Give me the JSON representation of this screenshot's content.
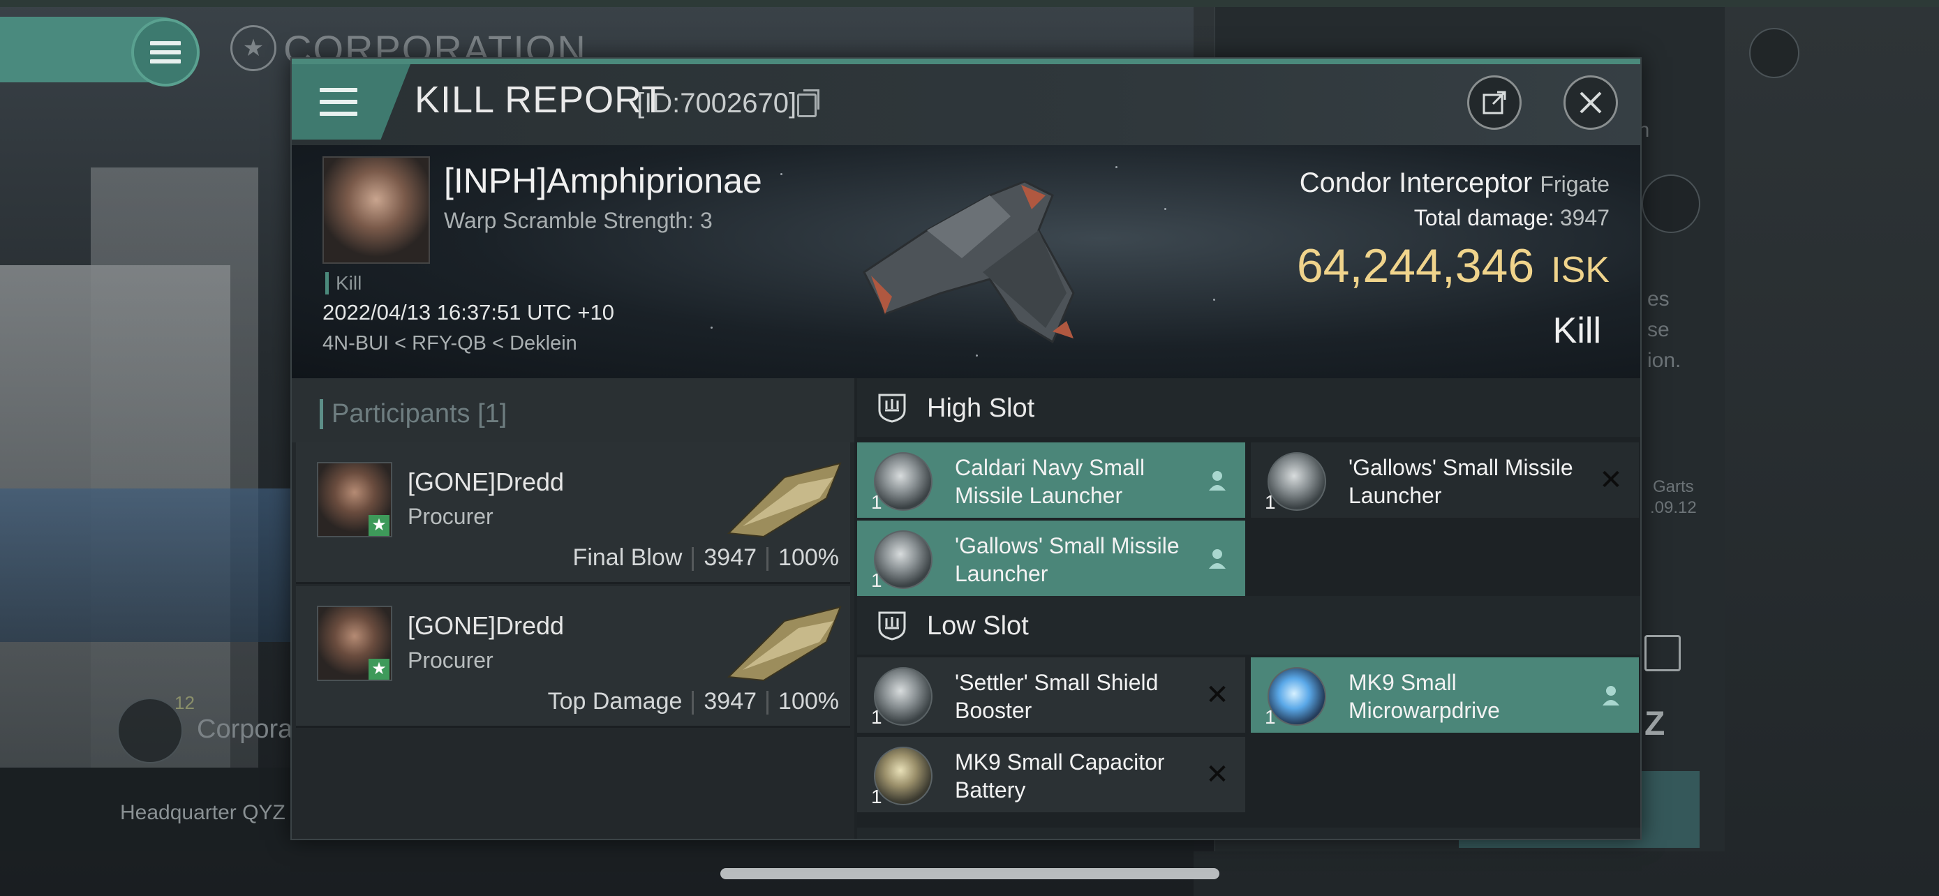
{
  "background": {
    "corp_title": "CORPORATION",
    "corp_sub": "Corpora",
    "corp_sub_badge": "12",
    "hq_label": "Headquarter QYZ",
    "right_fragments": [
      "en",
      "es",
      "se",
      "ion.",
      "Garts",
      ".09.12"
    ]
  },
  "window": {
    "title": "KILL REPORT",
    "id_label": "[ID:7002670]",
    "share_icon": "share-icon",
    "close_icon": "close-icon",
    "accent_color": "#4b8a7c"
  },
  "victim": {
    "name": "[INPH]Amphiprionae",
    "warp_scramble": "Warp Scramble Strength: 3",
    "tag": "Kill",
    "datetime": "2022/04/13 16:37:51 UTC +10",
    "location": "4N-BUI < RFY-QB < Deklein",
    "ship": "Condor Interceptor",
    "ship_class": "Frigate",
    "total_damage_label": "Total damage:",
    "total_damage": "3947",
    "isk_value": "64,244,346",
    "isk_unit": "ISK",
    "result": "Kill",
    "isk_color": "#f0d48c"
  },
  "participants": {
    "title": "Participants [1]",
    "rows": [
      {
        "name": "[GONE]Dredd",
        "ship": "Procurer",
        "role": "Final Blow",
        "damage": "3947",
        "percent": "100%"
      },
      {
        "name": "[GONE]Dredd",
        "ship": "Procurer",
        "role": "Top Damage",
        "damage": "3947",
        "percent": "100%"
      }
    ]
  },
  "fitting": {
    "high_slot": {
      "title": "High Slot",
      "modules": [
        {
          "name": "Caldari Navy Small Missile Launcher",
          "qty": "1",
          "state": "fitted"
        },
        {
          "name": "'Gallows' Small Missile Launcher",
          "qty": "1",
          "state": "destroyed"
        },
        {
          "name": "'Gallows' Small Missile Launcher",
          "qty": "1",
          "state": "fitted"
        }
      ]
    },
    "low_slot": {
      "title": "Low Slot",
      "modules": [
        {
          "name": "'Settler' Small Shield Booster",
          "qty": "1",
          "state": "destroyed"
        },
        {
          "name": "MK9 Small Microwarpdrive",
          "qty": "1",
          "state": "fitted"
        },
        {
          "name": "MK9 Small Capacitor Battery",
          "qty": "1",
          "state": "destroyed"
        }
      ]
    },
    "fitted_color": "#4b8679"
  }
}
